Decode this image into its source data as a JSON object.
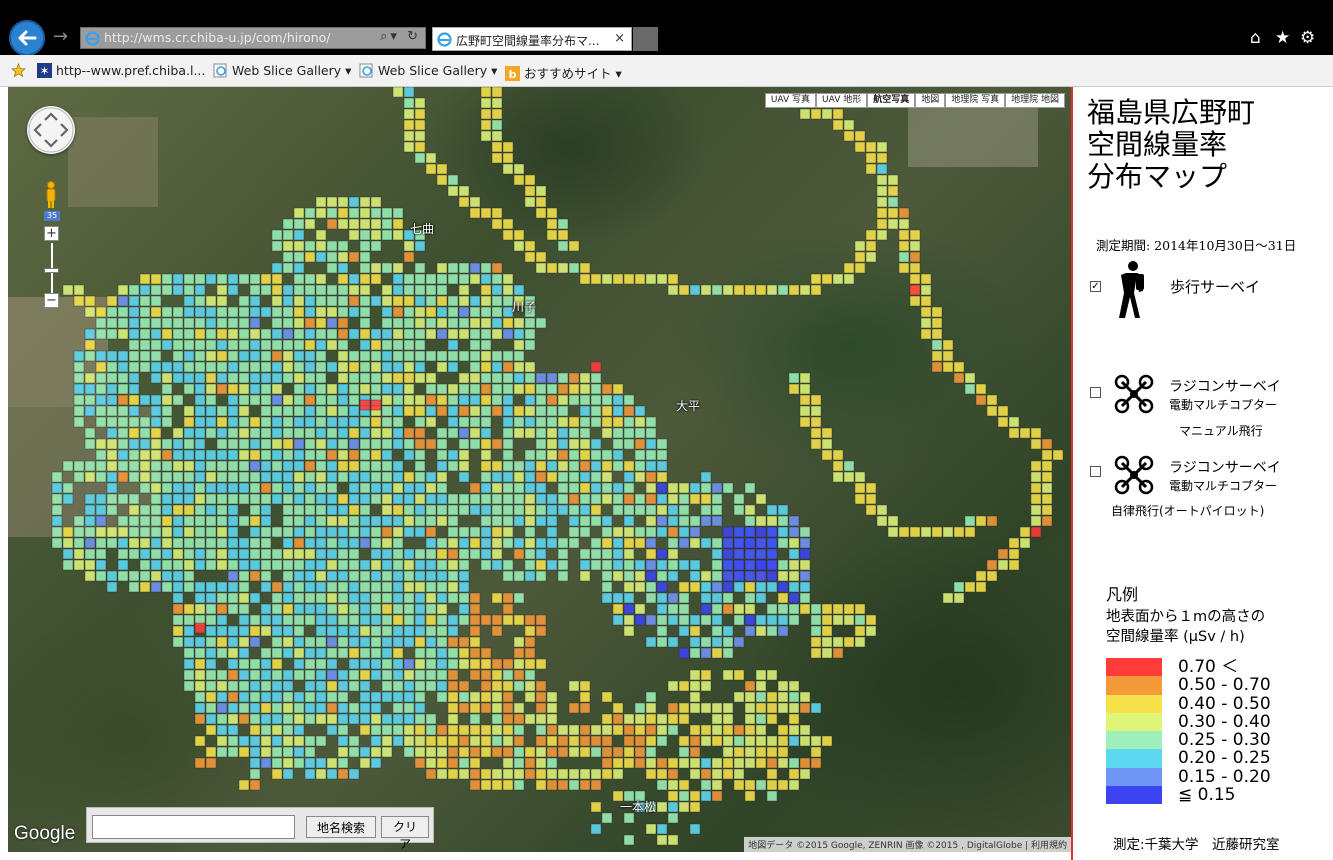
{
  "browser": {
    "address": "http://wms.cr.chiba-u.jp/com/hirono/",
    "tab_title": "広野町空間線量率分布マ...",
    "tab_close": "×",
    "favorites": [
      {
        "label": "http--www.pref.chiba.l...",
        "icon": "star-badge-icon"
      },
      {
        "label": "Web Slice Gallery ▾",
        "icon": "ie-page-icon"
      },
      {
        "label": "Web Slice Gallery ▾",
        "icon": "ie-page-icon"
      },
      {
        "label": "おすすめサイト ▾",
        "icon": "bing-icon"
      }
    ]
  },
  "map": {
    "types": [
      "UAV 写真",
      "UAV 地形",
      "航空写真",
      "地図",
      "地理院 写真",
      "地理院 地図"
    ],
    "active_type": "航空写真",
    "zoom_level": "35",
    "zoom_in": "+",
    "zoom_out": "−",
    "places": [
      {
        "name": "七曲"
      },
      {
        "name": "川子"
      },
      {
        "name": "大平"
      },
      {
        "name": "一本松"
      }
    ],
    "search_placeholder": "",
    "search_button": "地名検索",
    "clear_button": "クリア",
    "google": "Google",
    "attribution": "地図データ ©2015 Google, ZENRIN 画像 ©2015 , DigitalGlobe | 利用規約"
  },
  "panel": {
    "title": "福島県広野町\n空間線量率\n分布マップ",
    "period": "測定期間: 2014年10月30日〜31日",
    "walking_checked": true,
    "walking_label": "歩行サーベイ",
    "rc_label": "ラジコンサーベイ",
    "rc_sub": "電動マルチコプター",
    "manual_label": "マニュアル飛行",
    "auto_label": "自律飛行(オートパイロット)",
    "legend_title": "凡例",
    "legend_desc_1": "地表面から１mの高さの",
    "legend_desc_2": "空間線量率 (μSv / h)",
    "credit": "測定:千葉大学　近藤研究室"
  },
  "legend": [
    {
      "label": "0.70  ＜",
      "color": "#ff3b3b"
    },
    {
      "label": "0.50  -  0.70",
      "color": "#f59a3a"
    },
    {
      "label": "0.40  -  0.50",
      "color": "#f7e24b"
    },
    {
      "label": "0.30  -  0.40",
      "color": "#dff57a"
    },
    {
      "label": "0.25  -  0.30",
      "color": "#9cf0b8"
    },
    {
      "label": "0.20  -  0.25",
      "color": "#5fd8f2"
    },
    {
      "label": "0.15  -  0.20",
      "color": "#6f95f5"
    },
    {
      "label": "≦  0.15",
      "color": "#3b44f0"
    }
  ]
}
